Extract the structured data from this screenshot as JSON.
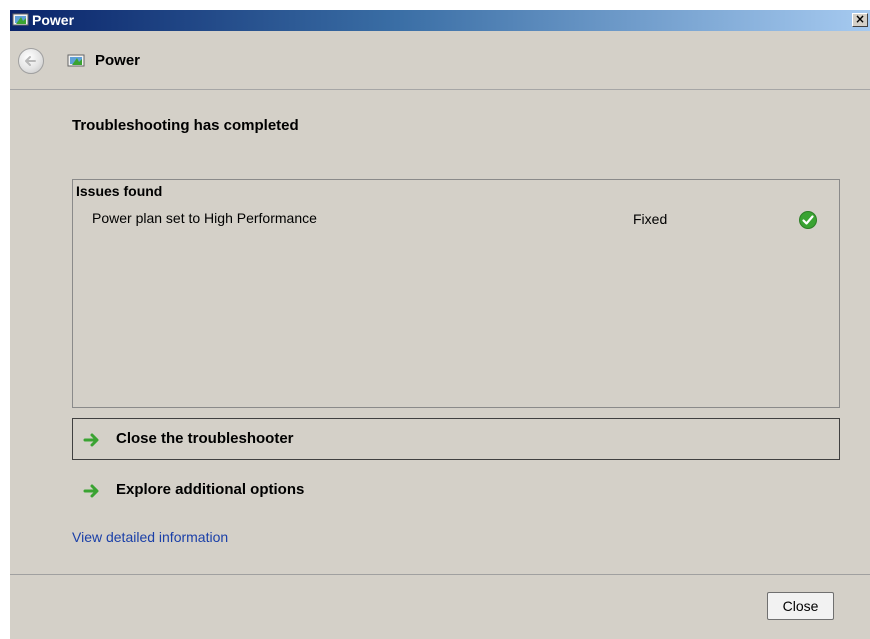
{
  "window": {
    "title": "Power",
    "close_glyph": "×"
  },
  "nav": {
    "title": "Power"
  },
  "main": {
    "heading": "Troubleshooting has completed",
    "issues": {
      "header": "Issues found",
      "rows": [
        {
          "name": "Power plan set to High Performance",
          "status": "Fixed",
          "icon": "green-check-icon"
        }
      ]
    },
    "commands": [
      {
        "label": "Close the troubleshooter",
        "icon": "green-arrow-icon"
      },
      {
        "label": "Explore additional options",
        "icon": "green-arrow-icon"
      }
    ],
    "link": "View detailed information"
  },
  "footer": {
    "close_label": "Close"
  },
  "colors": {
    "accent_green": "#3aa332",
    "link_blue": "#1a3fa8"
  }
}
